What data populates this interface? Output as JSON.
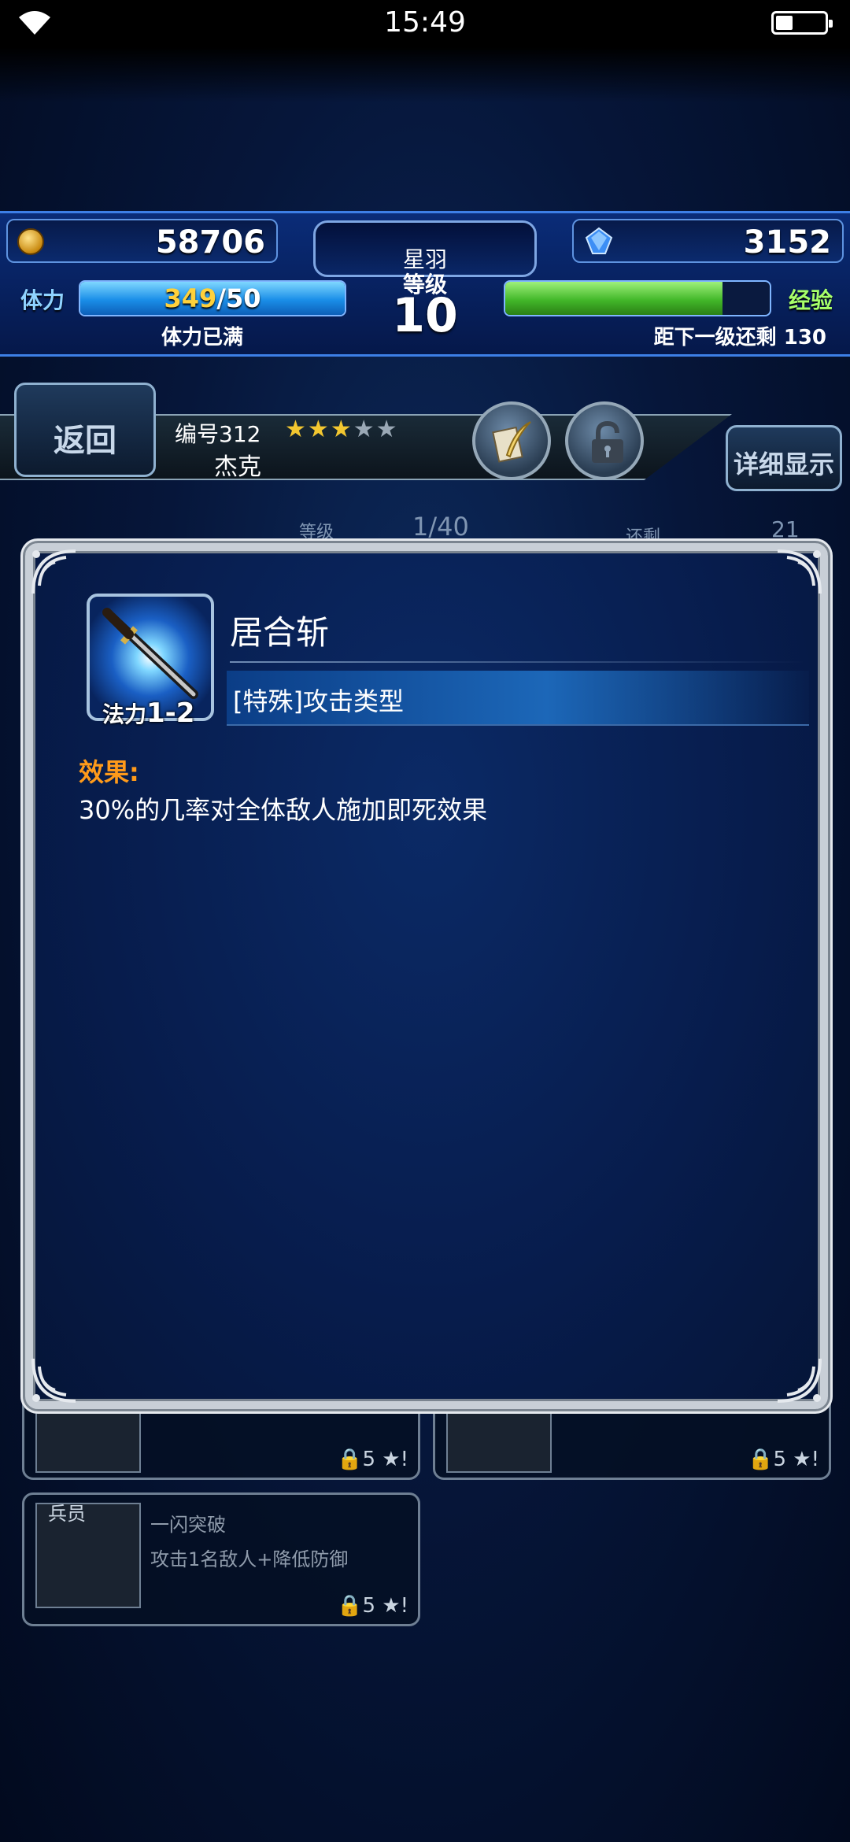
{
  "status_bar": {
    "time": "15:49",
    "battery_level": 0.35
  },
  "hud": {
    "gil": "58706",
    "gems": "3152",
    "player_name": "星羽",
    "level_label": "等级",
    "level": "10",
    "stamina_label": "体力",
    "stamina_current": "349",
    "stamina_max": "/50",
    "stamina_fill": 1.0,
    "stamina_status": "体力已满",
    "exp_label": "经验",
    "exp_fill": 0.82,
    "exp_status": "距下一级还剩 130"
  },
  "unit": {
    "back_label": "返回",
    "number": "编号312",
    "stars_filled": 3,
    "stars_total": 5,
    "name": "杰克",
    "detail_label": "详细显示"
  },
  "background_row": {
    "level_label": "等级",
    "level_value": "1/40",
    "remain_label": "还剩",
    "remain_value": "21"
  },
  "background_cards": [
    {
      "tag": "",
      "title": "",
      "desc": "",
      "footer": "🔒5 ★!"
    },
    {
      "tag": "",
      "title": "",
      "desc": "",
      "footer": "🔒5 ★!"
    },
    {
      "tag": "兵员",
      "title": "一闪突破",
      "desc": "攻击1名敌人+降低防御",
      "footer": "🔒5 ★!"
    }
  ],
  "modal": {
    "skill_name": "居合斩",
    "skill_type": "[特殊]攻击类型",
    "mp_label": "法力",
    "mp_value": "1-2",
    "effect_label": "效果:",
    "effect_text": "30%的几率对全体敌人施加即死效果"
  },
  "colors": {
    "accent_blue": "#3d7fe6",
    "stamina_cur": "#ffd13b",
    "exp_green": "#43b82a",
    "effect_orange": "#ff9a1a"
  }
}
